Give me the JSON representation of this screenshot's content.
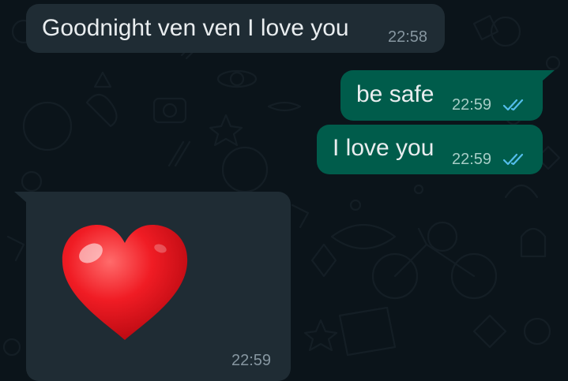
{
  "chat": {
    "messages": [
      {
        "direction": "incoming",
        "text": "Goodnight ven ven I love you",
        "time": "22:58"
      },
      {
        "direction": "outgoing",
        "text": "be safe",
        "time": "22:59",
        "status": "read",
        "status_icon": "double-check-icon"
      },
      {
        "direction": "outgoing",
        "text": "I love you",
        "time": "22:59",
        "status": "read",
        "status_icon": "double-check-icon"
      },
      {
        "direction": "incoming",
        "emoji": "red-heart",
        "time": "22:59"
      }
    ]
  },
  "colors": {
    "background": "#0b141a",
    "incoming_bubble": "#1f2c34",
    "outgoing_bubble": "#005c4b",
    "text": "#e9edef",
    "read_ticks": "#53bdeb",
    "heart": "#e3171f"
  }
}
